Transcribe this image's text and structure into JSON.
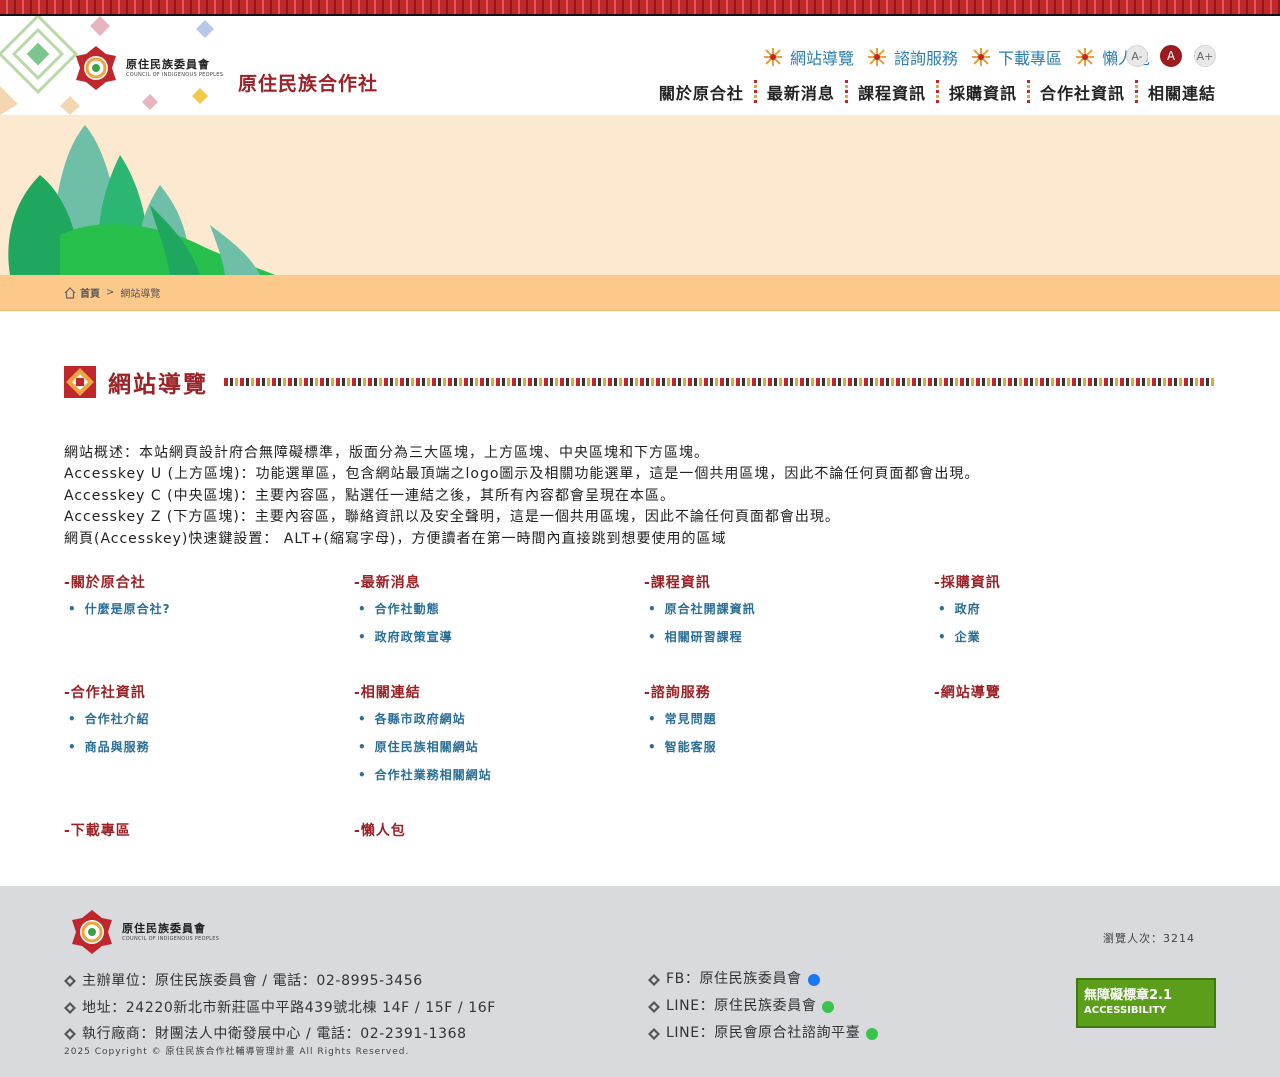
{
  "header": {
    "logo_cn": "原住民族委員會",
    "logo_en": "COUNCIL OF INDIGENOUS PEOPLES",
    "site_title": "原住民族合作社",
    "top_links": [
      "網站導覽",
      "諮詢服務",
      "下載專區",
      "懶人包"
    ],
    "font_sizes": [
      "A-",
      "A",
      "A+"
    ],
    "main_nav": [
      "關於原合社",
      "最新消息",
      "課程資訊",
      "採購資訊",
      "合作社資訊",
      "相關連結"
    ]
  },
  "breadcrumb": {
    "home": "首頁",
    "separator": ">",
    "current": "網站導覽"
  },
  "page": {
    "title": "網站導覽",
    "intro": [
      "網站概述：本站網頁設計府合無障礙標準，版面分為三大區塊，上方區塊、中央區塊和下方區塊。",
      "Accesskey U (上方區塊)：功能選單區，包含網站最頂端之logo圖示及相關功能選單，這是一個共用區塊，因此不論任何頁面都會出現。",
      "Accesskey C (中央區塊)：主要內容區，點選任一連結之後，其所有內容都會呈現在本區。",
      "Accesskey Z (下方區塊)：主要內容區，聯絡資訊以及安全聲明，這是一個共用區塊，因此不論任何頁面都會出現。",
      "網頁(Accesskey)快速鍵設置： ALT+(縮寫字母)，方便讀者在第一時間內直接跳到想要使用的區域"
    ],
    "sitemap": [
      {
        "title": "-關於原合社",
        "items": [
          "什麼是原合社?"
        ]
      },
      {
        "title": "-最新消息",
        "items": [
          "合作社動態",
          "政府政策宣導"
        ]
      },
      {
        "title": "-課程資訊",
        "items": [
          "原合社開課資訊",
          "相關研習課程"
        ]
      },
      {
        "title": "-採購資訊",
        "items": [
          "政府",
          "企業"
        ]
      },
      {
        "title": "-合作社資訊",
        "items": [
          "合作社介紹",
          "商品與服務"
        ]
      },
      {
        "title": "-相關連結",
        "items": [
          "各縣市政府網站",
          "原住民族相關網站",
          "合作社業務相關網站"
        ]
      },
      {
        "title": "-諮詢服務",
        "items": [
          "常見問題",
          "智能客服"
        ]
      },
      {
        "title": "-網站導覽",
        "items": []
      },
      {
        "title": "-下載專區",
        "items": []
      },
      {
        "title": "-懶人包",
        "items": []
      }
    ]
  },
  "footer": {
    "logo_cn": "原住民族委員會",
    "logo_en": "COUNCIL OF INDIGENOUS PEOPLES",
    "left": [
      "主辦單位：原住民族委員會 / 電話：02-8995-3456",
      "地址：24220新北市新莊區中平路439號北棟 14F / 15F / 16F",
      "執行廠商：財團法人中衛發展中心 / 電話：02-2391-1368"
    ],
    "right": [
      "FB：原住民族委員會",
      "LINE：原住民族委員會",
      "LINE：原民會原合社諮詢平臺"
    ],
    "copyright": "2025 Copyright © 原住民族合作社輔導管理計畫 All Rights Reserved.",
    "visits": "瀏覽人次：3214",
    "badge_line1": "無障礙標章2.1",
    "badge_line2": "ACCESSIBILITY"
  },
  "colors": {
    "brand_red": "#9b2226",
    "link_blue": "#2a6f97",
    "top_link": "#2b7fb0",
    "banner_bg": "#fde9cf",
    "breadbar": "#fdc98a",
    "footer_bg": "#d8dade"
  }
}
